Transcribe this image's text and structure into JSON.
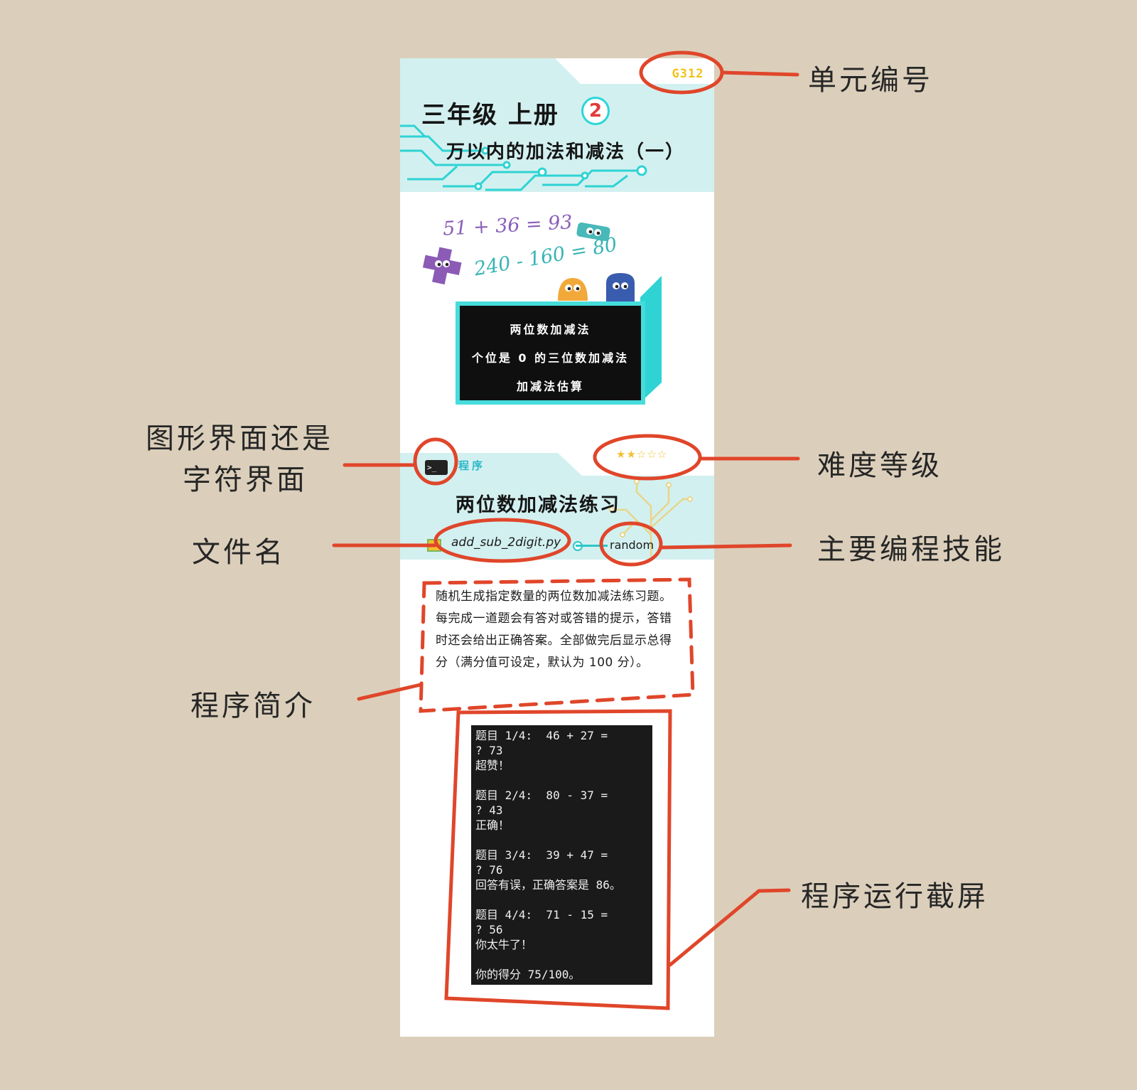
{
  "card": {
    "unit_code": "G312",
    "grade_title": "三年级 上册",
    "volume_badge": "2",
    "unit_title": "万以内的加法和减法（一）",
    "doodle_equations": [
      "51 + 36 = 93",
      "240 - 160 = 80"
    ],
    "topics": [
      "两位数加减法",
      "个位是 0 的三位数加减法",
      "加减法估算"
    ],
    "program": {
      "type_label": "程序",
      "terminal_icon_text": ">_",
      "stars": "★★☆☆☆",
      "difficulty_level": 2,
      "difficulty_max": 5,
      "title": "两位数加减法练习",
      "file_name": "add_sub_2digit.py",
      "skill": "random",
      "description": "随机生成指定数量的两位数加减法练习题。每完成一道题会有答对或答错的提示，答错时还会给出正确答案。全部做完后显示总得分（满分值可设定，默认为 100 分）。",
      "screenshot_lines": [
        "题目 1/4:  46 + 27 =",
        "? 73",
        "超赞！",
        "",
        "题目 2/4:  80 - 37 =",
        "? 43",
        "正确！",
        "",
        "题目 3/4:  39 + 47 =",
        "? 76",
        "回答有误，正确答案是 86。",
        "",
        "题目 4/4:  71 - 15 =",
        "? 56",
        "你太牛了！",
        "",
        "你的得分 75/100。"
      ]
    }
  },
  "callouts": {
    "unit_code": "单元编号",
    "ui_type_line1": "图形界面还是",
    "ui_type_line2": "字符界面",
    "difficulty": "难度等级",
    "file_name": "文件名",
    "skill": "主要编程技能",
    "intro": "程序简介",
    "screenshot": "程序运行截屏"
  },
  "colors": {
    "background": "#dbcfbb",
    "teal_band": "#d3f0f0",
    "accent_teal": "#2dd6d6",
    "annotation_red": "#e0462a",
    "unit_code_yellow": "#f3c21c"
  }
}
